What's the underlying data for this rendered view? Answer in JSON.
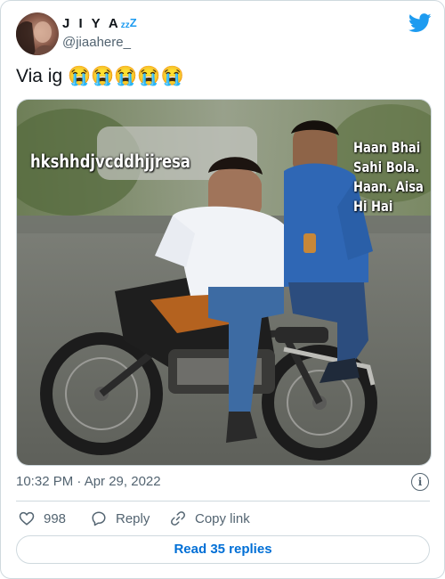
{
  "user": {
    "display_name": "J I Y A",
    "zzz_small": "zz",
    "zzz_big": "Z",
    "handle": "@jiaahere_"
  },
  "tweet": {
    "text": "Via ig 😭😭😭😭😭"
  },
  "media": {
    "caption_left": "hkshhdjvcddhjjresa",
    "caption_right": [
      "Haan Bhai",
      "Sahi Bola.",
      "Haan. Aisa",
      "Hi Hai"
    ]
  },
  "meta": {
    "timestamp": "10:32 PM · Apr 29, 2022",
    "info_icon_glyph": "i"
  },
  "actions": {
    "like_count": "998",
    "reply_label": "Reply",
    "copy_label": "Copy link"
  },
  "read_replies": "Read 35 replies",
  "colors": {
    "brand_blue": "#1d9bf0",
    "secondary_text": "#536471",
    "border": "#cfd9de"
  }
}
